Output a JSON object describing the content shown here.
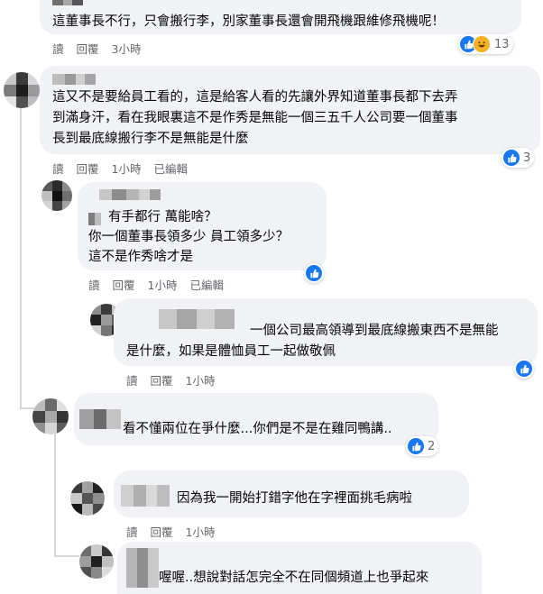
{
  "comments": [
    {
      "text": "這董事長不行，只會搬行李，別家董事長還會開飛機跟維修飛機呢！",
      "actions": [
        "讀",
        "回覆",
        "3小時"
      ],
      "reaction_count": "13"
    },
    {
      "text_lines": [
        "這又不是要給員工看的，這是給客人看的先讓外界知道董事長都下去弄",
        "到滿身汗，看在我眼裏這不是作秀是無能一個三五千人公司要一個董事",
        "長到最底線搬行李不是無能是什麼"
      ],
      "actions": [
        "讀",
        "回覆",
        "1小時",
        "已編輯"
      ],
      "reaction_count": "3"
    },
    {
      "text_lines": [
        "有手都行 萬能啥？",
        "你一個董事長領多少 員工領多少？",
        "這不是作秀啥才是"
      ],
      "actions": [
        "讀",
        "回覆",
        "1小時",
        "已編輯"
      ]
    },
    {
      "text_lines": [
        "一個公司最高領導到最底線搬東西不是無能",
        "是什麼，如果是體恤員工一起做敬佩"
      ],
      "actions": [
        "讀",
        "回覆",
        "1小時"
      ]
    },
    {
      "text": "看不懂兩位在爭什麼...你們是不是在雞同鴨講..",
      "reaction_count": "2"
    },
    {
      "text": "因為我一開始打錯字他在字裡面挑毛病啦",
      "actions": [
        "讀",
        "回覆",
        "1小時"
      ]
    },
    {
      "text": "喔喔..想說對話怎完全不在同個頻道上也爭起來"
    }
  ],
  "colors": {
    "bubble": "#f0f2f5",
    "meta": "#65676b",
    "like": "#1877f2",
    "haha": "#f7b125"
  },
  "icons": [
    "like-icon",
    "haha-icon"
  ]
}
